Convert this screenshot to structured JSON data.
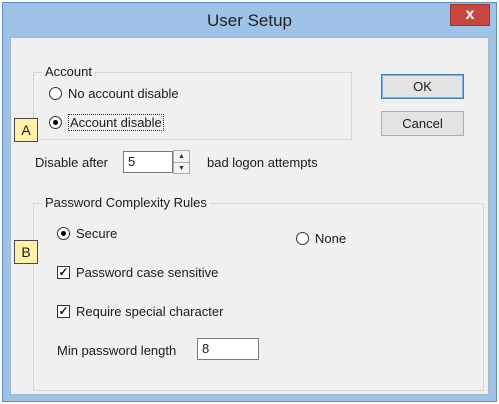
{
  "window": {
    "title": "User Setup",
    "close_label": "x"
  },
  "account": {
    "group_label": "Account",
    "option_none": "No account disable",
    "option_disable": "Account disable",
    "selected": "Account disable"
  },
  "buttons": {
    "ok": "OK",
    "cancel": "Cancel"
  },
  "logon": {
    "label_before": "Disable after",
    "value": "5",
    "label_after": "bad logon attempts"
  },
  "password": {
    "group_label": "Password Complexity Rules",
    "option_secure": "Secure",
    "option_none": "None",
    "selected": "Secure",
    "case_sensitive_label": "Password case sensitive",
    "case_sensitive_checked": true,
    "special_char_label": "Require special character",
    "special_char_checked": true,
    "min_length_label": "Min password length",
    "min_length_value": "8"
  },
  "callouts": {
    "a": "A",
    "b": "B"
  },
  "icons": {
    "close": "close-icon",
    "spin_up": "chevron-up-icon",
    "spin_down": "chevron-down-icon",
    "check": "checkmark-icon"
  }
}
